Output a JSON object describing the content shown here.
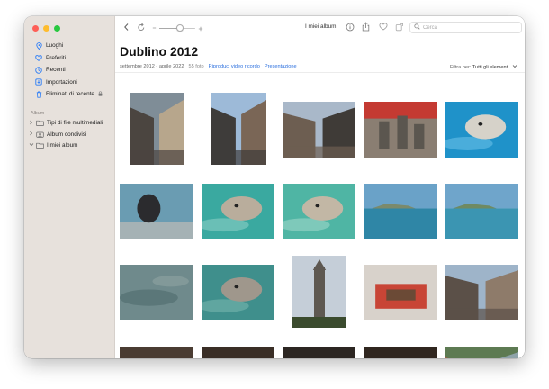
{
  "sidebar": {
    "items": [
      {
        "label": "Luoghi",
        "icon": "map-pin-icon"
      },
      {
        "label": "Preferiti",
        "icon": "heart-icon"
      },
      {
        "label": "Recenti",
        "icon": "clock-icon"
      },
      {
        "label": "Importazioni",
        "icon": "import-icon"
      },
      {
        "label": "Eliminati di recente",
        "icon": "trash-icon",
        "locked": true
      }
    ],
    "section_label": "Album",
    "tree": [
      {
        "label": "Tipi di file multimediali",
        "expanded": false,
        "icon": "folder-icon"
      },
      {
        "label": "Album condivisi",
        "expanded": false,
        "icon": "shared-album-icon"
      },
      {
        "label": "I miei album",
        "expanded": true,
        "icon": "folder-icon"
      }
    ]
  },
  "toolbar": {
    "title": "I miei album",
    "search_placeholder": "Cerca",
    "zoom_level": 0.58
  },
  "album": {
    "title": "Dublino 2012",
    "date_range": "settembre 2012 - aprile 2022",
    "photo_count": "55 foto",
    "play_memory": "Riproduci video ricordo",
    "slideshow": "Presentazione",
    "filter_label": "Filtra per:",
    "filter_value": "Tutti gli elementi"
  },
  "photos": [
    {
      "subject": "street",
      "colors": [
        "#7f8d97",
        "#4b4540",
        "#b7a68c"
      ]
    },
    {
      "subject": "building",
      "colors": [
        "#9dbad8",
        "#3e3c3a",
        "#7a6656"
      ]
    },
    {
      "subject": "building",
      "colors": [
        "#a9b8c9",
        "#6d5e51",
        "#3f3b37"
      ]
    },
    {
      "subject": "statues",
      "colors": [
        "#8a7e72",
        "#c43a32",
        "#5b564f"
      ]
    },
    {
      "subject": "seal-water",
      "colors": [
        "#1f92c9",
        "#67c0e8",
        "#d6d2c9"
      ]
    },
    {
      "subject": "bird",
      "colors": [
        "#6a9cb2",
        "#2b2b2e",
        "#a5b2b5"
      ]
    },
    {
      "subject": "seal-water",
      "colors": [
        "#3aa9a0",
        "#8bcfc4",
        "#b9ad9c"
      ]
    },
    {
      "subject": "seal-water",
      "colors": [
        "#4fb5a4",
        "#9ed7c9",
        "#c2b7a5"
      ]
    },
    {
      "subject": "sea",
      "colors": [
        "#6aa2c8",
        "#2f86a6",
        "#7b8a6c"
      ]
    },
    {
      "subject": "sea",
      "colors": [
        "#6fa5cb",
        "#3b95b2",
        "#6f8a62"
      ]
    },
    {
      "subject": "sea-grey",
      "colors": [
        "#6f8a8c",
        "#4f6a6d",
        "#96a7a6"
      ]
    },
    {
      "subject": "seal-water",
      "colors": [
        "#3f8f8c",
        "#76b6ae",
        "#9f978c"
      ]
    },
    {
      "subject": "tower",
      "colors": [
        "#c5ced8",
        "#5e5851",
        "#3b4b2e"
      ]
    },
    {
      "subject": "museum",
      "colors": [
        "#d8d2cb",
        "#c84536",
        "#6b4a36"
      ]
    },
    {
      "subject": "street",
      "colors": [
        "#9eb4c9",
        "#5b5048",
        "#8e7b6a"
      ]
    },
    {
      "subject": "museum",
      "colors": [
        "#4a3c32",
        "#9a8674",
        "#6b5a4c"
      ]
    },
    {
      "subject": "museum",
      "colors": [
        "#3a2e26",
        "#b08a5c",
        "#6c5440"
      ]
    },
    {
      "subject": "museum",
      "colors": [
        "#2c2622",
        "#a57c55",
        "#4b3c31"
      ]
    },
    {
      "subject": "museum",
      "colors": [
        "#30261f",
        "#a47856",
        "#54443a"
      ]
    },
    {
      "subject": "street",
      "colors": [
        "#5d7a52",
        "#c64a3c",
        "#8ea3a9"
      ]
    }
  ]
}
